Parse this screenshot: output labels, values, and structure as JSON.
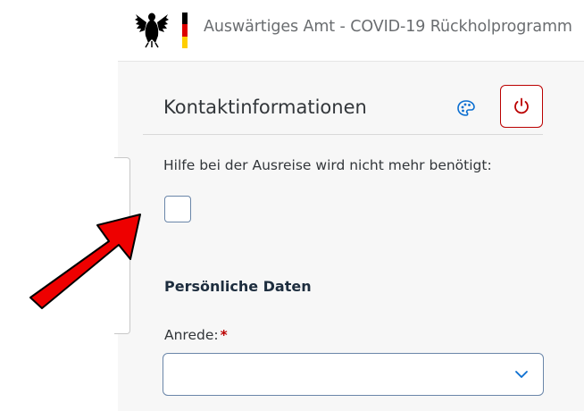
{
  "header": {
    "title": "Auswärtiges Amt - COVID-19 Rückholprogramm",
    "flag_colors": [
      "#000000",
      "#dd0000",
      "#ffce00"
    ]
  },
  "section": {
    "title": "Kontaktinformationen",
    "palette_icon": "palette-icon",
    "power_icon": "power-icon"
  },
  "help": {
    "label": "Hilfe bei der Ausreise wird nicht mehr benötigt:",
    "checked": false
  },
  "personal": {
    "group_title": "Persönliche Daten",
    "anrede_label": "Anrede:",
    "required_marker": "*",
    "anrede_value": ""
  },
  "colors": {
    "accent": "#bb0000",
    "arrow": "#ee0000",
    "field_border": "#6a86a9"
  }
}
